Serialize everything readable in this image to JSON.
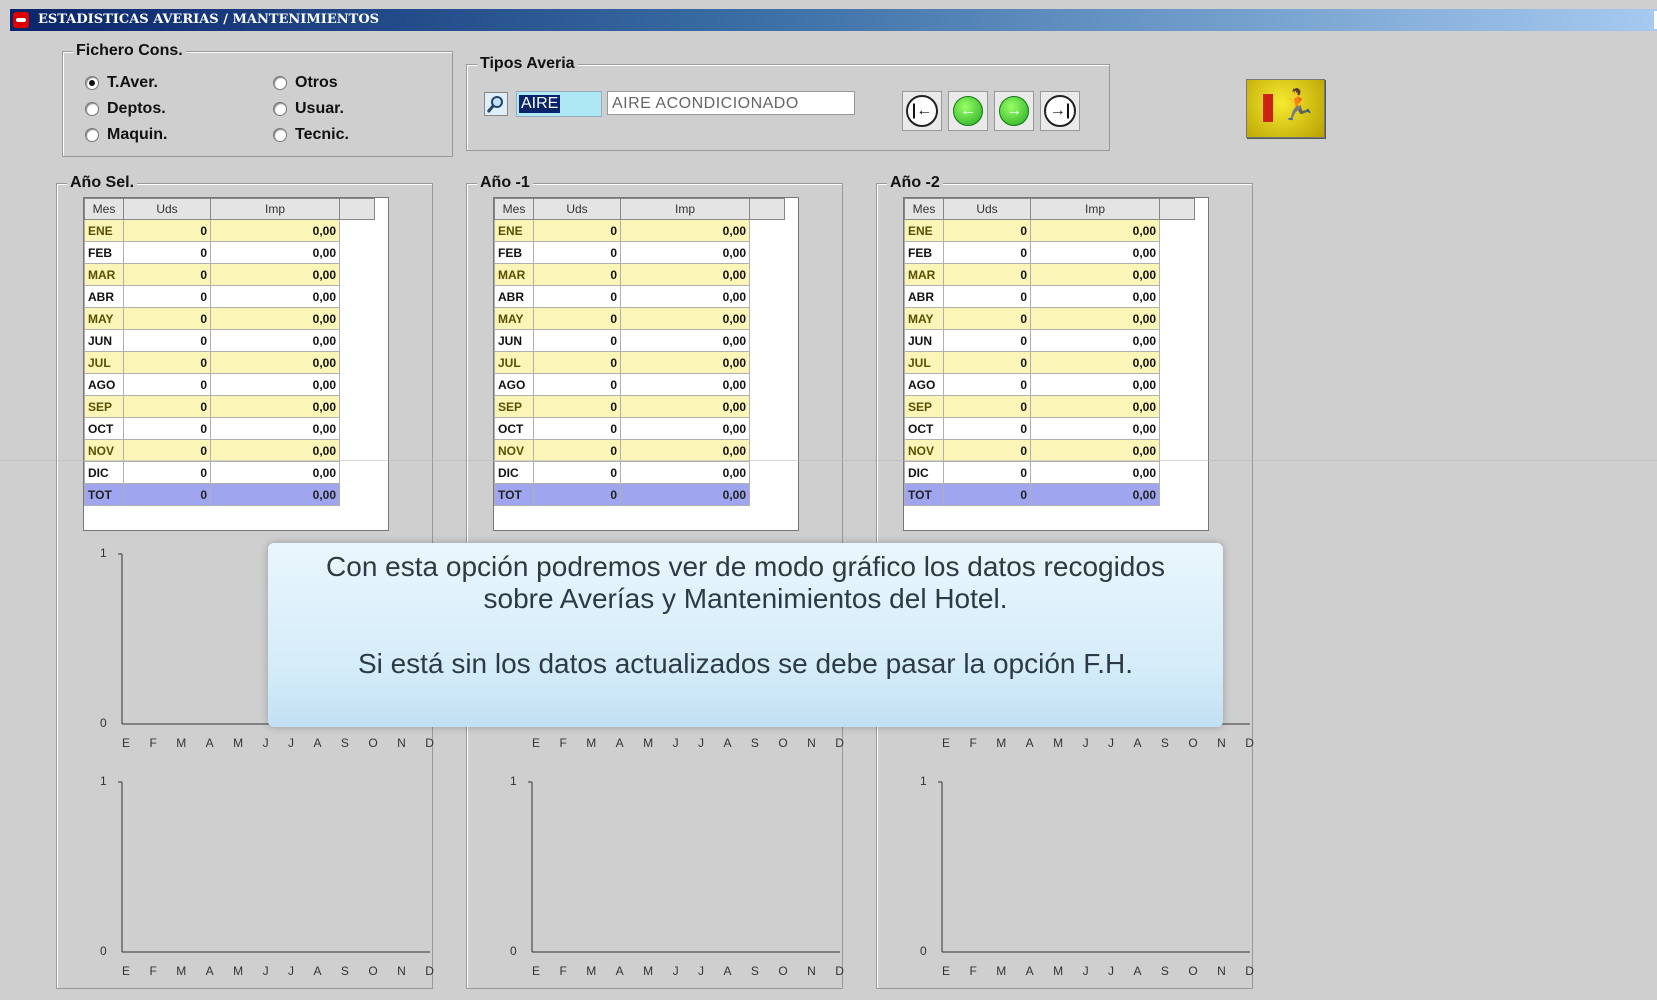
{
  "window": {
    "title": "ESTADISTICAS AVERIAS / MANTENIMIENTOS"
  },
  "fichero": {
    "legend": "Fichero Cons.",
    "options": [
      "T.Aver.",
      "Otros",
      "Deptos.",
      "Usuar.",
      "Maquin.",
      "Tecnic."
    ],
    "selected": "T.Aver."
  },
  "tipos": {
    "legend": "Tipos Averia",
    "code": "AIRE",
    "description": "AIRE ACONDICIONADO"
  },
  "nav": [
    "first-icon",
    "prev-icon",
    "next-icon",
    "last-icon"
  ],
  "colors": {
    "odd_row": "#fbf5b8",
    "total_row": "#9fa5ef",
    "code_field": "#aee8f5"
  },
  "table_headers": [
    "Mes",
    "Uds",
    "Imp"
  ],
  "panels": [
    {
      "title": "Año Sel.",
      "rows": [
        [
          "ENE",
          "0",
          "0,00"
        ],
        [
          "FEB",
          "0",
          "0,00"
        ],
        [
          "MAR",
          "0",
          "0,00"
        ],
        [
          "ABR",
          "0",
          "0,00"
        ],
        [
          "MAY",
          "0",
          "0,00"
        ],
        [
          "JUN",
          "0",
          "0,00"
        ],
        [
          "JUL",
          "0",
          "0,00"
        ],
        [
          "AGO",
          "0",
          "0,00"
        ],
        [
          "SEP",
          "0",
          "0,00"
        ],
        [
          "OCT",
          "0",
          "0,00"
        ],
        [
          "NOV",
          "0",
          "0,00"
        ],
        [
          "DIC",
          "0",
          "0,00"
        ],
        [
          "TOT",
          "0",
          "0,00"
        ]
      ]
    },
    {
      "title": "Año -1",
      "rows": [
        [
          "ENE",
          "0",
          "0,00"
        ],
        [
          "FEB",
          "0",
          "0,00"
        ],
        [
          "MAR",
          "0",
          "0,00"
        ],
        [
          "ABR",
          "0",
          "0,00"
        ],
        [
          "MAY",
          "0",
          "0,00"
        ],
        [
          "JUN",
          "0",
          "0,00"
        ],
        [
          "JUL",
          "0",
          "0,00"
        ],
        [
          "AGO",
          "0",
          "0,00"
        ],
        [
          "SEP",
          "0",
          "0,00"
        ],
        [
          "OCT",
          "0",
          "0,00"
        ],
        [
          "NOV",
          "0",
          "0,00"
        ],
        [
          "DIC",
          "0",
          "0,00"
        ],
        [
          "TOT",
          "0",
          "0,00"
        ]
      ]
    },
    {
      "title": "Año -2",
      "rows": [
        [
          "ENE",
          "0",
          "0,00"
        ],
        [
          "FEB",
          "0",
          "0,00"
        ],
        [
          "MAR",
          "0",
          "0,00"
        ],
        [
          "ABR",
          "0",
          "0,00"
        ],
        [
          "MAY",
          "0",
          "0,00"
        ],
        [
          "JUN",
          "0",
          "0,00"
        ],
        [
          "JUL",
          "0",
          "0,00"
        ],
        [
          "AGO",
          "0",
          "0,00"
        ],
        [
          "SEP",
          "0",
          "0,00"
        ],
        [
          "OCT",
          "0",
          "0,00"
        ],
        [
          "NOV",
          "0",
          "0,00"
        ],
        [
          "DIC",
          "0",
          "0,00"
        ],
        [
          "TOT",
          "0",
          "0,00"
        ]
      ]
    }
  ],
  "chart_data": {
    "type": "bar",
    "categories": [
      "E",
      "F",
      "M",
      "A",
      "M",
      "J",
      "J",
      "A",
      "S",
      "O",
      "N",
      "D"
    ],
    "ylim": [
      0,
      1
    ],
    "yticks": [
      "1",
      "0"
    ],
    "series_values": [
      0,
      0,
      0,
      0,
      0,
      0,
      0,
      0,
      0,
      0,
      0,
      0
    ]
  },
  "overlay": {
    "line1": "Con esta opción podremos ver de modo gráfico los datos recogidos",
    "line2": "sobre Averías y Mantenimientos del Hotel.",
    "line3": "Si está sin los datos actualizados se debe pasar la opción F.H."
  }
}
